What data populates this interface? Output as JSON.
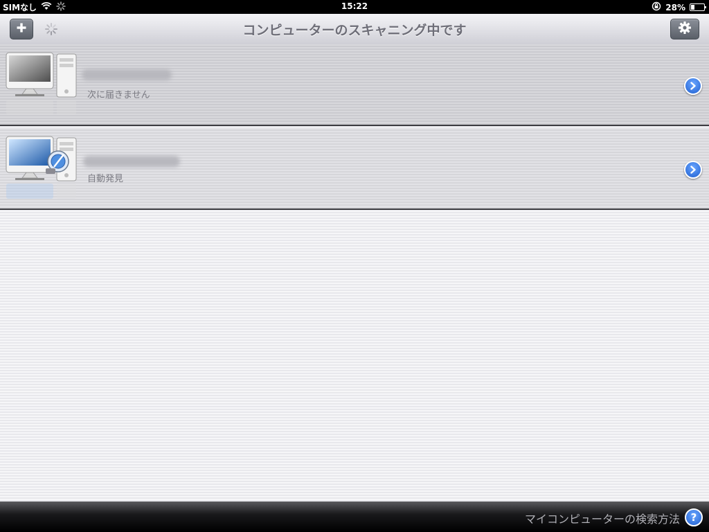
{
  "status_bar": {
    "carrier": "SIMなし",
    "time": "15:22",
    "battery": "28%"
  },
  "toolbar": {
    "title": "コンピューターのスキャニング中です",
    "add_icon": "plus-icon",
    "settings_icon": "gear-icon"
  },
  "computers": [
    {
      "status": "次に届きません",
      "icon": "computer-offline-icon"
    },
    {
      "status": "自動発見",
      "icon": "computer-discovered-icon"
    }
  ],
  "footer": {
    "help_label": "マイコンピューターの検索方法",
    "help_icon": "?"
  },
  "colors": {
    "accent": "#1f5fd0",
    "toolbar_button": "#5a5f68"
  }
}
